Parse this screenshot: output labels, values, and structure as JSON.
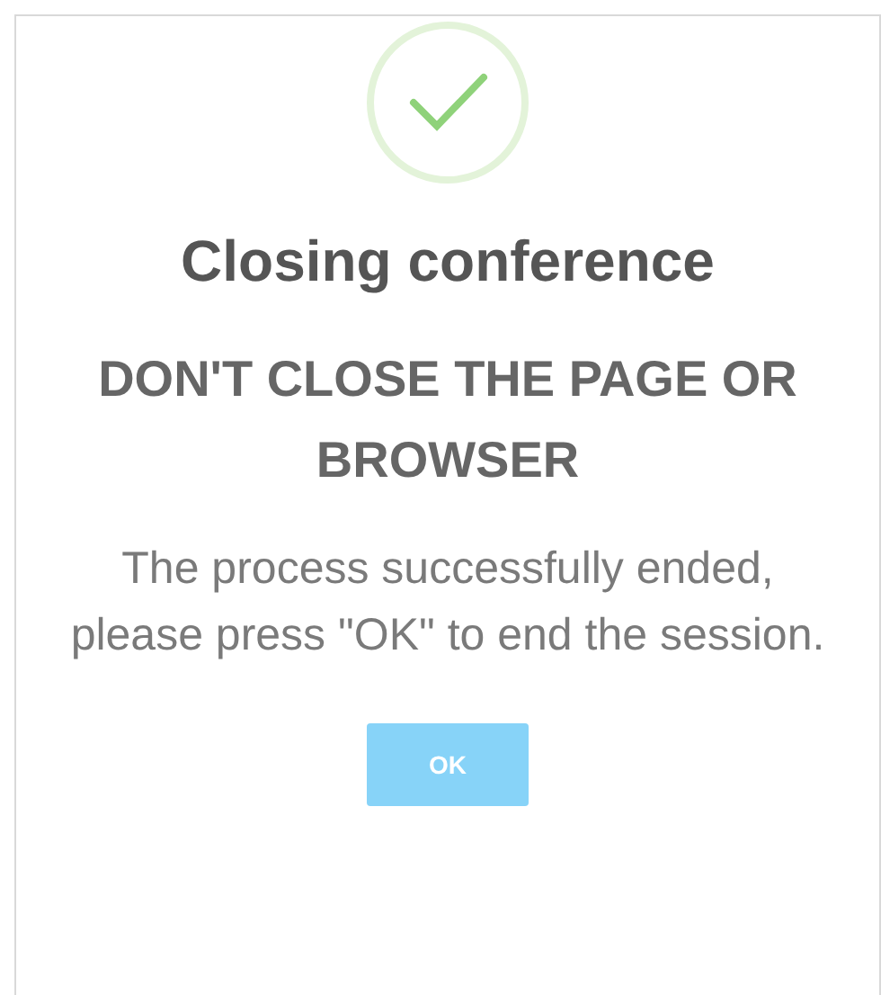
{
  "dialog": {
    "title": "Closing conference",
    "warning": "DON'T CLOSE THE PAGE OR BROWSER",
    "message": "The process successfully ended, please press \"OK\" to end the session.",
    "buttons": [
      "OK"
    ]
  }
}
